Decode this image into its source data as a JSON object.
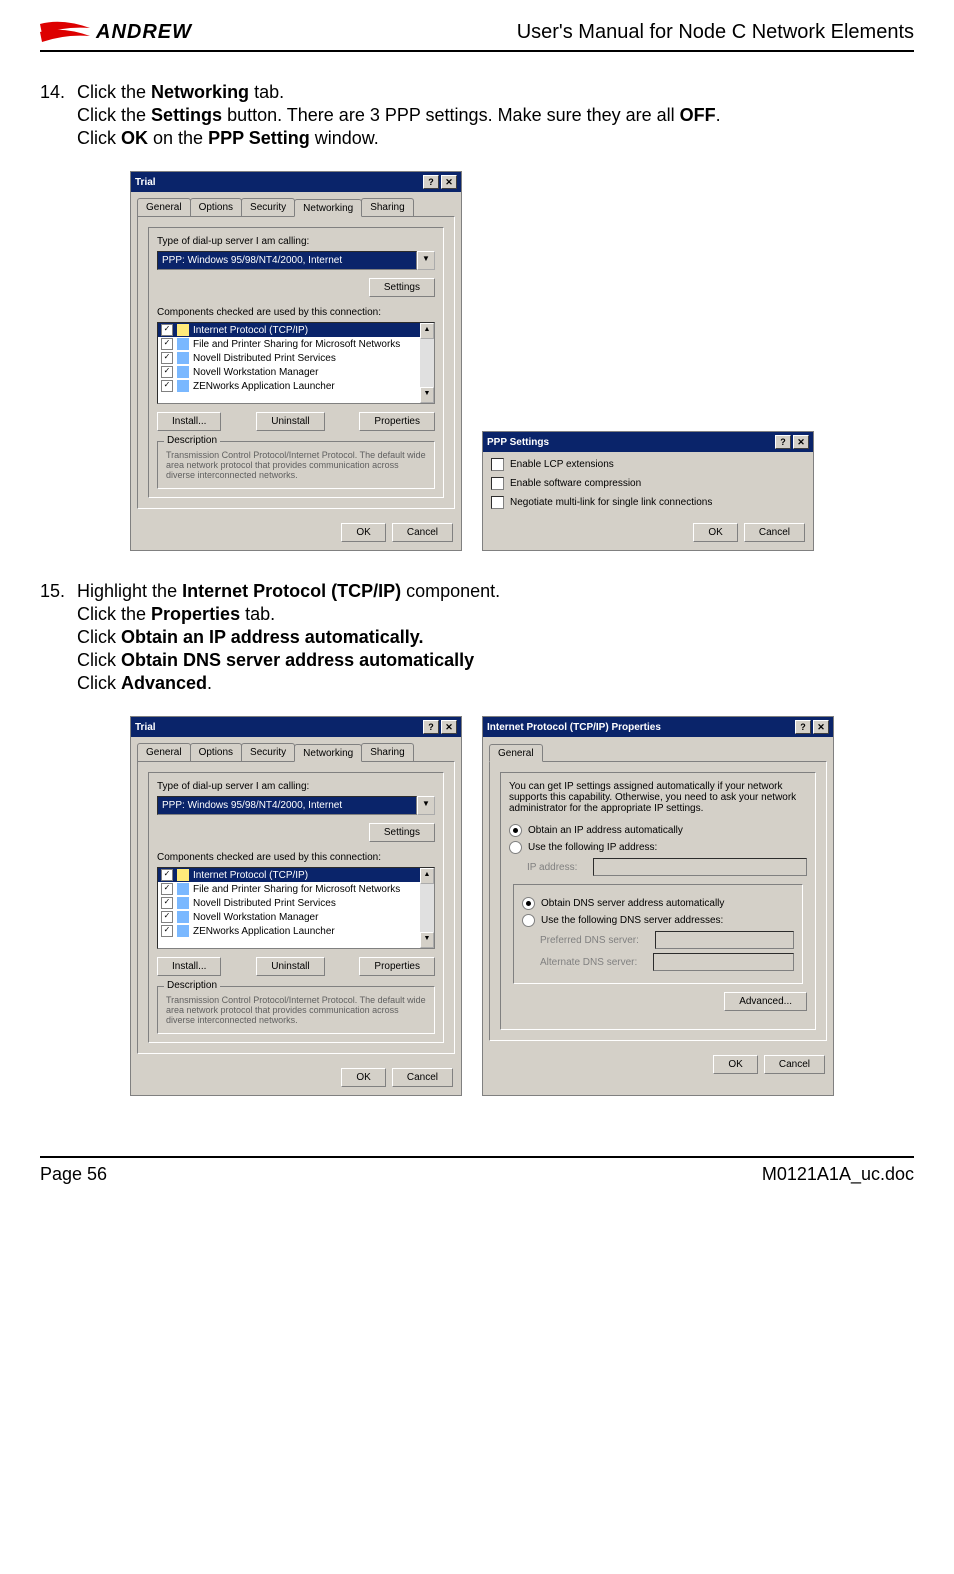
{
  "logo": {
    "brand": "ANDREW"
  },
  "doc_title": "User's Manual for Node C Network Elements",
  "steps": {
    "s14": {
      "num": "14.",
      "l1a": "Click the ",
      "l1b": "Networking",
      "l1c": " tab.",
      "l2a": "Click the ",
      "l2b": "Settings",
      "l2c": " button. There are 3 PPP settings. Make sure they are all ",
      "l2d": "OFF",
      "l2e": ".",
      "l3a": "Click ",
      "l3b": "OK",
      "l3c": " on the ",
      "l3d": "PPP Setting",
      "l3e": " window."
    },
    "s15": {
      "num": "15.",
      "l1a": "Highlight the ",
      "l1b": "Internet Protocol (TCP/IP)",
      "l1c": " component.",
      "l2a": "Click the ",
      "l2b": "Properties",
      "l2c": " tab.",
      "l3a": "Click ",
      "l3b": "Obtain an IP address automatically.",
      "l4a": "Click ",
      "l4b": "Obtain DNS server address automatically",
      "l5a": "Click ",
      "l5b": "Advanced",
      "l5c": "."
    }
  },
  "dlg_trial": {
    "title": "Trial",
    "tabs": {
      "general": "General",
      "options": "Options",
      "security": "Security",
      "networking": "Networking",
      "sharing": "Sharing"
    },
    "lbl_type": "Type of dial-up server I am calling:",
    "combo_val": "PPP: Windows 95/98/NT4/2000, Internet",
    "btn_settings": "Settings",
    "lbl_components": "Components checked are used by this connection:",
    "components": [
      "Internet Protocol (TCP/IP)",
      "File and Printer Sharing for Microsoft Networks",
      "Novell Distributed Print Services",
      "Novell Workstation Manager",
      "ZENworks Application Launcher"
    ],
    "btn_install": "Install...",
    "btn_uninstall": "Uninstall",
    "btn_properties": "Properties",
    "grp_desc": "Description",
    "desc_txt": "Transmission Control Protocol/Internet Protocol. The default wide area network protocol that provides communication across diverse interconnected networks.",
    "btn_ok": "OK",
    "btn_cancel": "Cancel"
  },
  "dlg_ppp": {
    "title": "PPP Settings",
    "opts": [
      "Enable LCP extensions",
      "Enable software compression",
      "Negotiate multi-link for single link connections"
    ],
    "btn_ok": "OK",
    "btn_cancel": "Cancel"
  },
  "dlg_ip": {
    "title": "Internet Protocol (TCP/IP) Properties",
    "tab_general": "General",
    "info": "You can get IP settings assigned automatically if your network supports this capability. Otherwise, you need to ask your network administrator for the appropriate IP settings.",
    "rad_auto_ip": "Obtain an IP address automatically",
    "rad_use_ip": "Use the following IP address:",
    "lbl_ip": "IP address:",
    "rad_auto_dns": "Obtain DNS server address automatically",
    "rad_use_dns": "Use the following DNS server addresses:",
    "lbl_pref": "Preferred DNS server:",
    "lbl_alt": "Alternate DNS server:",
    "btn_adv": "Advanced...",
    "btn_ok": "OK",
    "btn_cancel": "Cancel"
  },
  "footer": {
    "page": "Page 56",
    "fname": "M0121A1A_uc.doc"
  },
  "glyphs": {
    "help": "?",
    "close": "✕",
    "down": "▼",
    "up": "▲",
    "check": "✓"
  }
}
